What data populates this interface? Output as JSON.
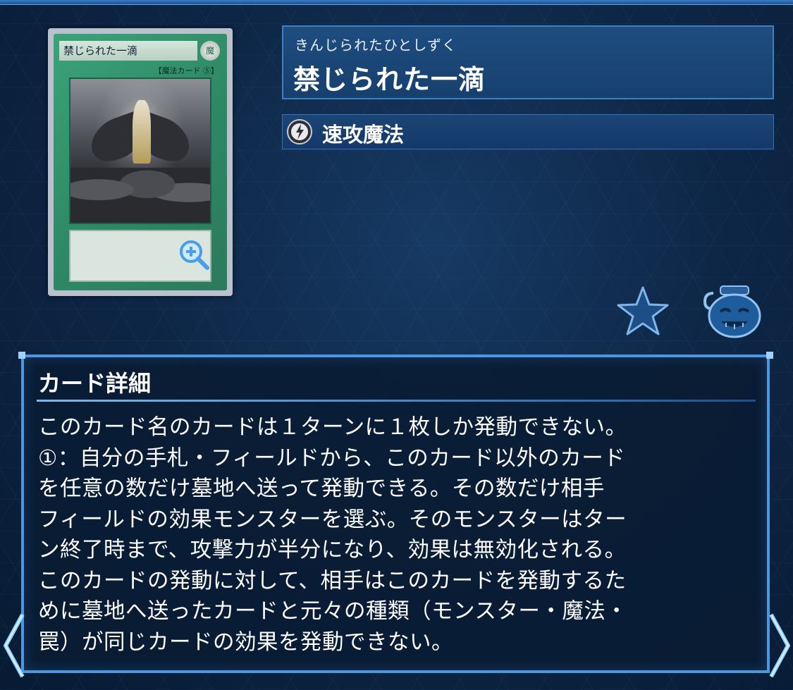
{
  "card_image": {
    "name_text": "禁じられた一滴",
    "attribute_text": "魔",
    "type_text": "【魔法カード ⑤】"
  },
  "card": {
    "reading": "きんじられたひとしずく",
    "name": "禁じられた一滴",
    "spell_type": "速攻魔法"
  },
  "details": {
    "heading": "カード詳細",
    "text": "このカード名のカードは１ターンに１枚しか発動できない。\n①：自分の手札・フィールドから、このカード以外のカード\nを任意の数だけ墓地へ送って発動できる。その数だけ相手\nフィールドの効果モンスターを選ぶ。そのモンスターはター\nン終了時まで、攻撃力が半分になり、効果は無効化される。\nこのカードの発動に対して、相手はこのカードを発動するた\nめに墓地へ送ったカードと元々の種類（モンスター・魔法・\n罠）が同じカードの効果を発動できない。"
  },
  "icons": {
    "zoom": "zoom-in-icon",
    "favorite": "star-icon",
    "pot": "pot-of-greed-icon",
    "spell": "quick-play-spell-icon",
    "nav_left": "chevron-left-icon",
    "nav_right": "chevron-right-icon"
  },
  "colors": {
    "panel_border": "#4a97e2",
    "background": "#0e2747",
    "card_green": "#2f8a66"
  }
}
